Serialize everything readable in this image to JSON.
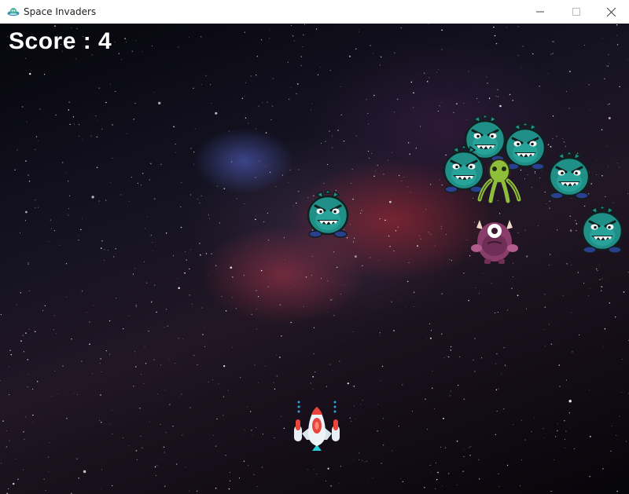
{
  "window": {
    "title": "Space Invaders",
    "app_icon": "alien-ufo-icon",
    "controls": [
      "minimize-icon",
      "maximize-icon",
      "close-icon"
    ]
  },
  "hud": {
    "score_text": "Score : 4"
  },
  "colors": {
    "titlebar": "#ffffff",
    "score": "#ffffff",
    "enemy_teal": "#1f8f87",
    "enemy_purple": "#8a3d6b",
    "octopus_green": "#8fbf3a",
    "ship_body": "#e8eef5",
    "ship_red": "#e8463c"
  },
  "sprites": {
    "player": "spaceship-icon",
    "enemies": [
      "teal-monster-icon",
      "teal-monster-icon",
      "teal-monster-icon",
      "teal-monster-icon",
      "teal-monster-icon",
      "teal-monster-icon",
      "green-octopus-icon",
      "purple-cyclops-icon"
    ]
  }
}
